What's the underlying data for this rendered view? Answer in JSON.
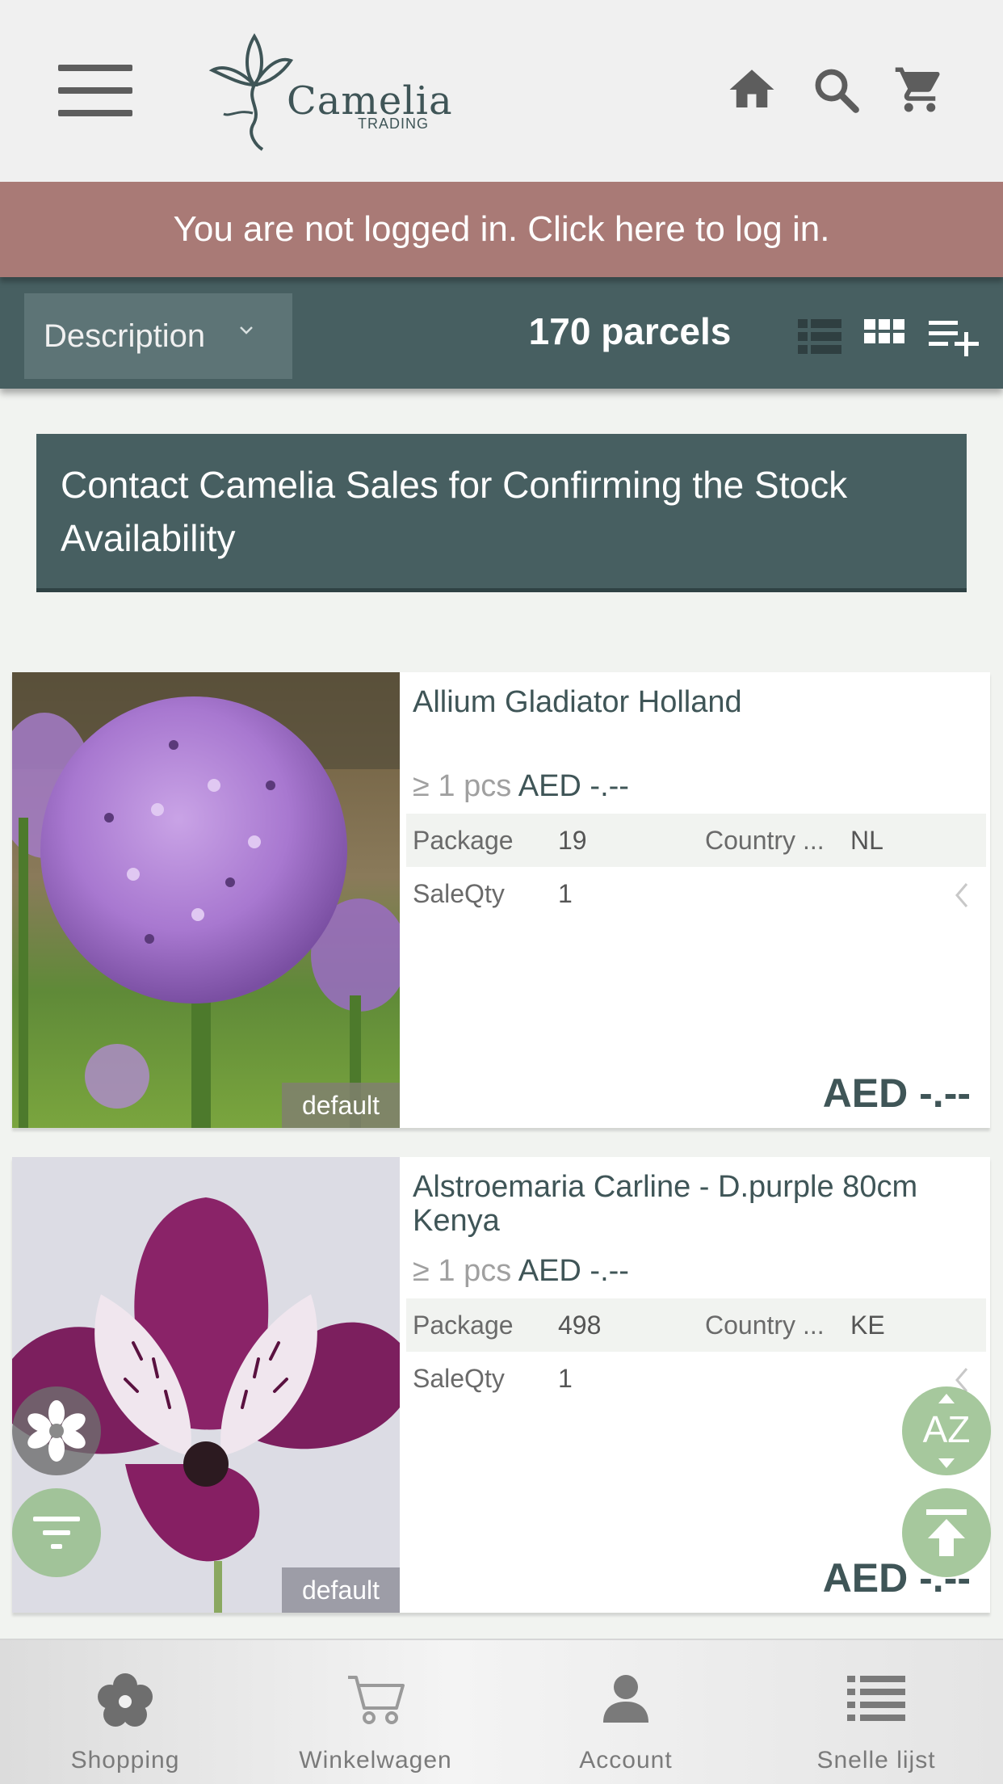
{
  "header": {
    "logo_text": "Camelia",
    "logo_subtext": "TRADING"
  },
  "login_banner": {
    "text": "You are not logged in. Click here to log in."
  },
  "toolbar": {
    "sort_selected": "Description",
    "parcel_count": "170 parcels"
  },
  "notice": {
    "text": "Contact Camelia Sales for Confirming the Stock Availability"
  },
  "products": [
    {
      "title": "Allium Gladiator Holland",
      "qty_prefix": "≥ 1 pcs",
      "unit_price": "AED -.--",
      "package_label": "Package",
      "package_value": "19",
      "country_label": "Country ...",
      "country_value": "NL",
      "saleqty_label": "SaleQty",
      "saleqty_value": "1",
      "price": "AED -.--",
      "image_tag": "default"
    },
    {
      "title": "Alstroemaria Carline - D.purple 80cm Kenya",
      "qty_prefix": "≥ 1 pcs",
      "unit_price": "AED -.--",
      "package_label": "Package",
      "package_value": "498",
      "country_label": "Country ...",
      "country_value": "KE",
      "saleqty_label": "SaleQty",
      "saleqty_value": "1",
      "price": "AED -.--",
      "image_tag": "default"
    }
  ],
  "fabs": {
    "sort_az_label": "AZ"
  },
  "bottom_nav": {
    "items": [
      {
        "label": "Shopping",
        "icon": "flower-icon"
      },
      {
        "label": "Winkelwagen",
        "icon": "cart-icon"
      },
      {
        "label": "Account",
        "icon": "user-icon"
      },
      {
        "label": "Snelle lijst",
        "icon": "list-icon"
      }
    ]
  },
  "colors": {
    "brand_teal": "#475f61",
    "login_banner": "#a97a76",
    "fab_green": "#96be8c"
  }
}
